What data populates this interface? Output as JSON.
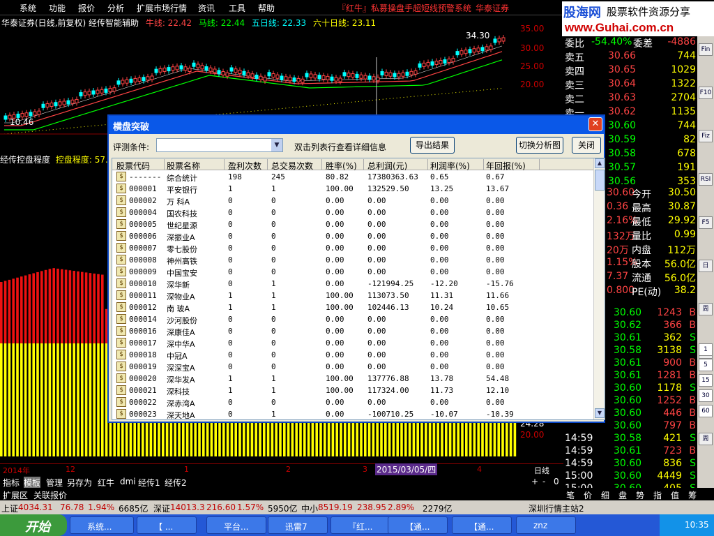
{
  "menu": {
    "items": [
      "系统",
      "功能",
      "报价",
      "分析",
      "扩展市场行情",
      "资讯",
      "工具",
      "帮助"
    ],
    "promo": "『红牛』私募操盘手超短线预警系统",
    "broker": "华泰证券"
  },
  "logo": {
    "cn": "股海网",
    "tag": "股票软件资源分享",
    "url": "www.Guhai.com.cn"
  },
  "chart": {
    "title_prefix": "华泰证券(日线,前复权) 经传智能辅助",
    "ma_labels": [
      "牛线: 22.42",
      "马线: 22.44",
      "五日线: 22.33",
      "六十日线: 23.11"
    ],
    "ma_colors": [
      "#ff4444",
      "#00ff00",
      "#00ffff",
      "#ffff00"
    ],
    "high_mark": "34.30",
    "low_mark": "10.46",
    "sub_title": "经传控盘程度",
    "sub_value": "控盘程度: 57.0",
    "y_ticks": [
      "35.00",
      "30.00",
      "25.00",
      "20.00"
    ],
    "low_ticks": [
      "24.28",
      "20.00"
    ],
    "date_labels": [
      "2014年",
      "12",
      "1",
      "2",
      "3",
      "4"
    ],
    "date_highlight": "2015/03/05/四",
    "period": "日线",
    "zoom_ctrl": [
      "+",
      "-",
      "0"
    ]
  },
  "tabs": [
    "指标",
    "模板",
    "管理",
    "另存为",
    "红牛",
    "dmi",
    "经传1",
    "经传2"
  ],
  "tabs2": [
    "扩展区",
    "关联报价"
  ],
  "orderbook": [
    {
      "label": "委比",
      "price": "-54.40%",
      "label2": "委差",
      "vol": "-4886"
    },
    {
      "label": "卖五",
      "price": "30.66",
      "vol": "744"
    },
    {
      "label": "卖四",
      "price": "30.65",
      "vol": "1029"
    },
    {
      "label": "卖三",
      "price": "30.64",
      "vol": "1322"
    },
    {
      "label": "卖二",
      "price": "30.63",
      "vol": "2704"
    },
    {
      "label": "卖一",
      "price": "30.62",
      "vol": "1135"
    },
    {
      "label": "",
      "price": "30.60",
      "vol": "744"
    },
    {
      "label": "",
      "price": "30.59",
      "vol": "82"
    },
    {
      "label": "",
      "price": "30.58",
      "vol": "678"
    },
    {
      "label": "",
      "price": "30.57",
      "vol": "191"
    },
    {
      "label": "",
      "price": "30.56",
      "vol": "353"
    }
  ],
  "stats": [
    {
      "a": "30.60",
      "k": "今开",
      "v": "30.50"
    },
    {
      "a": "0.36",
      "k": "最高",
      "v": "30.87"
    },
    {
      "a": "2.16%",
      "k": "最低",
      "v": "29.92"
    },
    {
      "a": "132万",
      "k": "量比",
      "v": "0.99"
    },
    {
      "a": "20万",
      "k": "内盘",
      "v": "112万"
    },
    {
      "a": "1.15%",
      "k": "股本",
      "v": "56.0亿"
    },
    {
      "a": "7.37",
      "k": "流通",
      "v": "56.0亿"
    },
    {
      "a": "0.800",
      "k": "PE(动)",
      "v": "38.2"
    }
  ],
  "ticks": [
    {
      "t": "",
      "p": "30.60",
      "v": "1243",
      "d": "B"
    },
    {
      "t": "",
      "p": "30.62",
      "v": "366",
      "d": "B"
    },
    {
      "t": "",
      "p": "30.61",
      "v": "362",
      "d": "S"
    },
    {
      "t": "",
      "p": "30.58",
      "v": "3138",
      "d": "S"
    },
    {
      "t": "",
      "p": "30.61",
      "v": "900",
      "d": "B"
    },
    {
      "t": "",
      "p": "30.61",
      "v": "1281",
      "d": "B"
    },
    {
      "t": "",
      "p": "30.60",
      "v": "1178",
      "d": "S"
    },
    {
      "t": "",
      "p": "30.60",
      "v": "1252",
      "d": "B"
    },
    {
      "t": "",
      "p": "30.60",
      "v": "446",
      "d": "B"
    },
    {
      "t": "",
      "p": "30.60",
      "v": "797",
      "d": "B"
    },
    {
      "t": "14:59",
      "p": "30.58",
      "v": "421",
      "d": "S"
    },
    {
      "t": "14:59",
      "p": "30.61",
      "v": "723",
      "d": "B"
    },
    {
      "t": "14:59",
      "p": "30.60",
      "v": "836",
      "d": "S"
    },
    {
      "t": "15:00",
      "p": "30.60",
      "v": "4449",
      "d": "S"
    },
    {
      "t": "15:00",
      "p": "30.60",
      "v": "405",
      "d": "S"
    }
  ],
  "right_tabs": [
    "笔",
    "价",
    "细",
    "盘",
    "势",
    "指",
    "值",
    "筹"
  ],
  "right_toolbar": [
    "Fin",
    "F10",
    "Fiz",
    "RSI",
    "F5",
    "日",
    "周",
    "月",
    "多",
    "周"
  ],
  "right_numbers": [
    "1",
    "5",
    "15",
    "30",
    "60"
  ],
  "indexbar": {
    "sh_label": "上证",
    "sh_val": "4034.31",
    "sh_chg": "76.78",
    "sh_pct": "1.94%",
    "sh_amt": "6685亿",
    "sz_label": "深证",
    "sz_val": "14013.3",
    "sz_chg": "216.60",
    "sz_pct": "1.57%",
    "sz_amt": "5950亿",
    "zx_label": "中小",
    "zx_val": "8519.19",
    "zx_chg": "238.95",
    "zx_pct": "2.89%",
    "zx_amt": "2279亿",
    "station": "深圳行情主站2"
  },
  "taskbar": {
    "start": "开始",
    "items": [
      "系统...",
      "【 ...",
      "平台...",
      "迅雷7",
      "『红...",
      "【通...",
      "【通...",
      "znz"
    ],
    "time": "10:35"
  },
  "dialog": {
    "title": "横盘突破",
    "filter_label": "评测条件:",
    "filter_value": "",
    "hint": "双击列表行查看详细信息",
    "export_btn": "导出结果",
    "switch_btn": "切换分析图",
    "close_btn": "关闭",
    "columns": [
      "股票代码",
      "股票名称",
      "盈利次数",
      "总交易次数",
      "胜率(%)",
      "总利润(元)",
      "利润率(%)",
      "年回报(%)"
    ],
    "rows": [
      [
        "-------",
        "综合统计",
        "198",
        "245",
        "80.82",
        "17380363.63",
        "0.65",
        "0.67"
      ],
      [
        "000001",
        "平安银行",
        "1",
        "1",
        "100.00",
        "132529.50",
        "13.25",
        "13.67"
      ],
      [
        "000002",
        "万 科A",
        "0",
        "0",
        "0.00",
        "0.00",
        "0.00",
        "0.00"
      ],
      [
        "000004",
        "国农科技",
        "0",
        "0",
        "0.00",
        "0.00",
        "0.00",
        "0.00"
      ],
      [
        "000005",
        "世纪星源",
        "0",
        "0",
        "0.00",
        "0.00",
        "0.00",
        "0.00"
      ],
      [
        "000006",
        "深振业A",
        "0",
        "0",
        "0.00",
        "0.00",
        "0.00",
        "0.00"
      ],
      [
        "000007",
        "零七股份",
        "0",
        "0",
        "0.00",
        "0.00",
        "0.00",
        "0.00"
      ],
      [
        "000008",
        "神州高铁",
        "0",
        "0",
        "0.00",
        "0.00",
        "0.00",
        "0.00"
      ],
      [
        "000009",
        "中国宝安",
        "0",
        "0",
        "0.00",
        "0.00",
        "0.00",
        "0.00"
      ],
      [
        "000010",
        "深华新",
        "0",
        "1",
        "0.00",
        "-121994.25",
        "-12.20",
        "-15.76"
      ],
      [
        "000011",
        "深物业A",
        "1",
        "1",
        "100.00",
        "113073.50",
        "11.31",
        "11.66"
      ],
      [
        "000012",
        "南 玻A",
        "1",
        "1",
        "100.00",
        "102446.13",
        "10.24",
        "10.65"
      ],
      [
        "000014",
        "沙河股份",
        "0",
        "0",
        "0.00",
        "0.00",
        "0.00",
        "0.00"
      ],
      [
        "000016",
        "深康佳A",
        "0",
        "0",
        "0.00",
        "0.00",
        "0.00",
        "0.00"
      ],
      [
        "000017",
        "深中华A",
        "0",
        "0",
        "0.00",
        "0.00",
        "0.00",
        "0.00"
      ],
      [
        "000018",
        "中冠A",
        "0",
        "0",
        "0.00",
        "0.00",
        "0.00",
        "0.00"
      ],
      [
        "000019",
        "深深宝A",
        "0",
        "0",
        "0.00",
        "0.00",
        "0.00",
        "0.00"
      ],
      [
        "000020",
        "深华发A",
        "1",
        "1",
        "100.00",
        "137776.88",
        "13.78",
        "54.48"
      ],
      [
        "000021",
        "深科技",
        "1",
        "1",
        "100.00",
        "117324.00",
        "11.73",
        "12.10"
      ],
      [
        "000022",
        "深赤湾A",
        "0",
        "0",
        "0.00",
        "0.00",
        "0.00",
        "0.00"
      ],
      [
        "000023",
        "深天地A",
        "0",
        "1",
        "0.00",
        "-100710.25",
        "-10.07",
        "-10.39"
      ]
    ]
  }
}
